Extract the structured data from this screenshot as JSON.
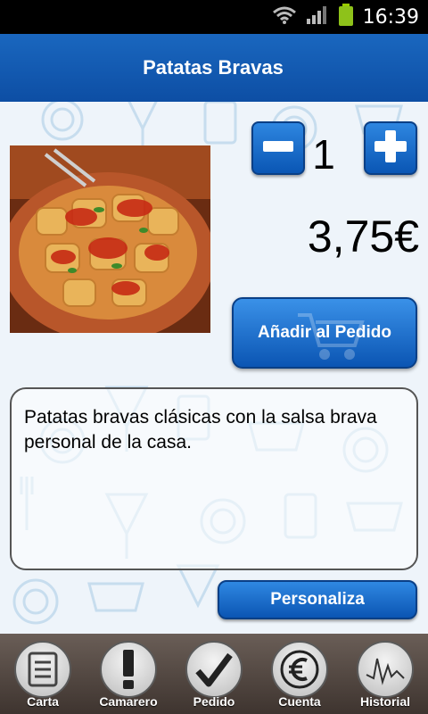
{
  "status": {
    "time": "16:39"
  },
  "header": {
    "title": "Patatas Bravas"
  },
  "product": {
    "quantity": "1",
    "price": "3,75€",
    "add_label": "Añadir al Pedido",
    "description": "Patatas bravas clásicas con la salsa brava personal de la casa.",
    "customize_label": "Personaliza"
  },
  "nav": [
    {
      "label": "Carta",
      "icon": "menu-card-icon"
    },
    {
      "label": "Camarero",
      "icon": "exclamation-icon"
    },
    {
      "label": "Pedido",
      "icon": "checkmark-icon"
    },
    {
      "label": "Cuenta",
      "icon": "euro-icon"
    },
    {
      "label": "Historial",
      "icon": "history-chart-icon"
    }
  ],
  "colors": {
    "accent": "#0d4ea4",
    "nav_bg": "#4e443e"
  }
}
